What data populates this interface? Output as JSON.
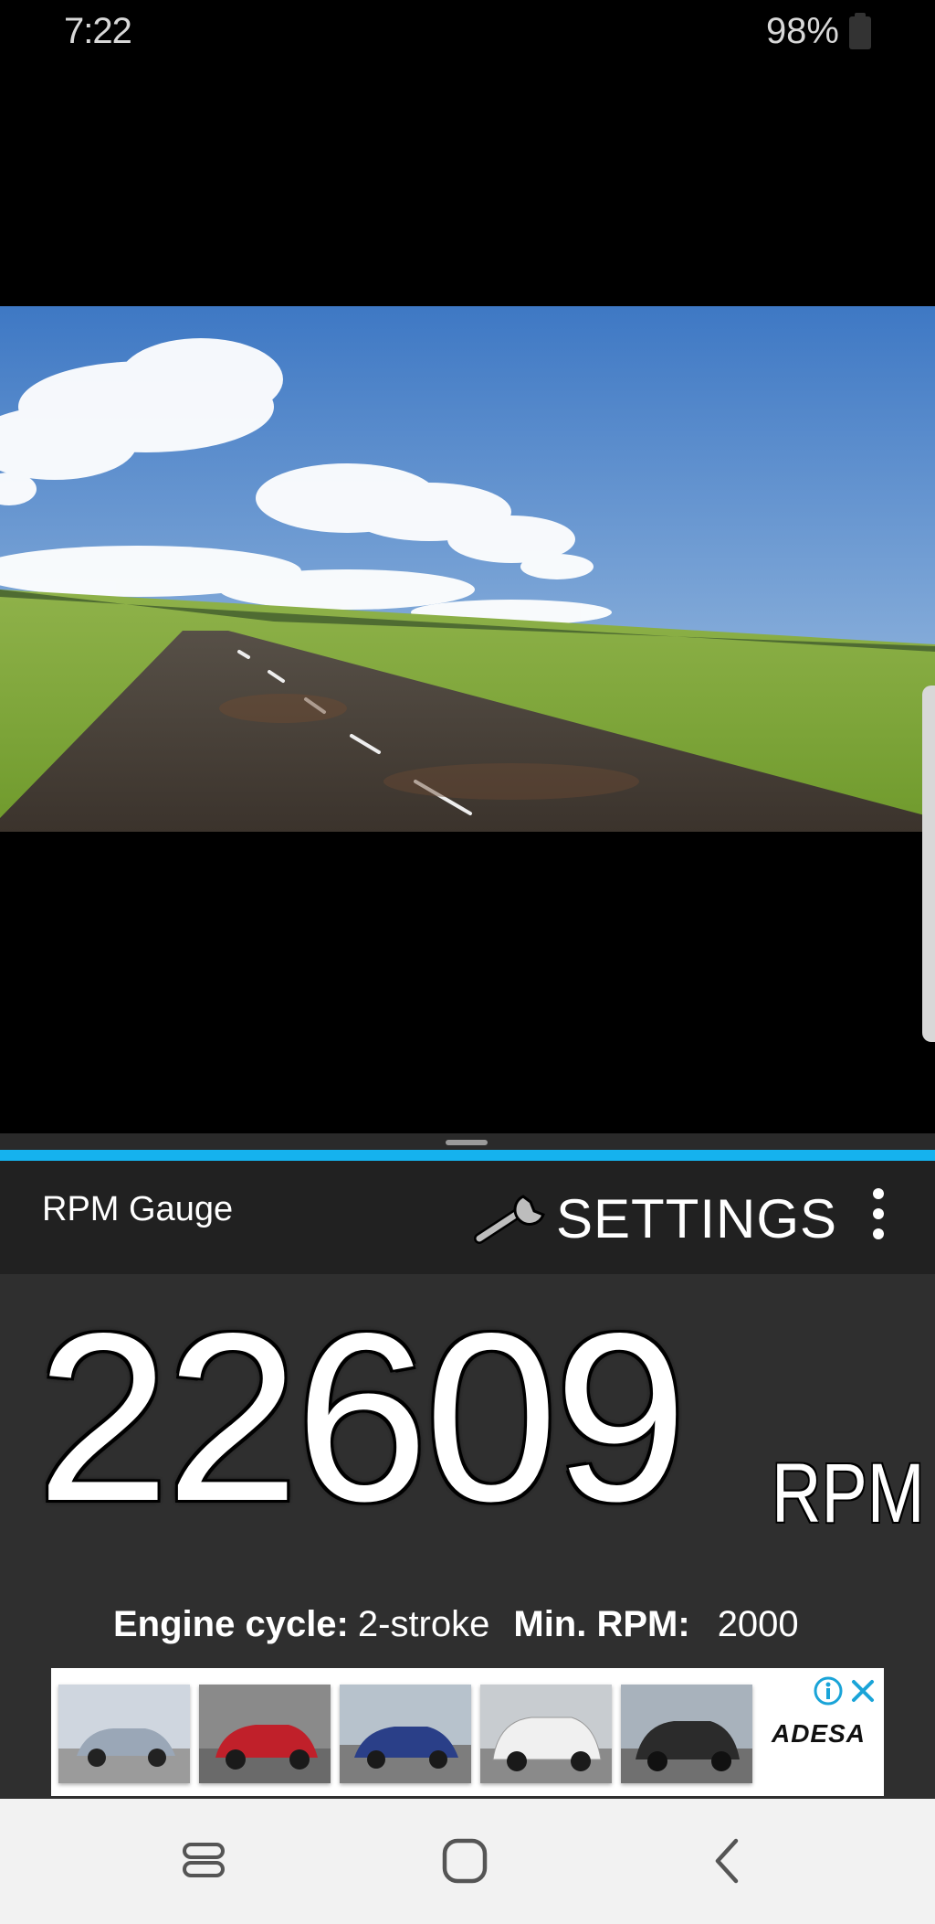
{
  "status_bar": {
    "time": "7:22",
    "battery": "98%"
  },
  "app": {
    "title": "RPM Gauge",
    "settings_label": "SETTINGS",
    "accent_color": "#15b2ee",
    "rpm_value": "22609",
    "rpm_unit": "RPM",
    "engine_cycle_label": "Engine cycle:",
    "engine_cycle_value": "2-stroke",
    "min_rpm_label": "Min. RPM:",
    "min_rpm_value": "2000"
  },
  "ad": {
    "brand": "ADESA",
    "thumbnails": [
      {
        "car_color": "#9aa7b7"
      },
      {
        "car_color": "#c0202a"
      },
      {
        "car_color": "#2a3f88"
      },
      {
        "car_color": "#f0f0f0"
      },
      {
        "car_color": "#2b2b2b"
      }
    ]
  },
  "icons": [
    "wrench-icon",
    "more-vert-icon",
    "ad-info-icon",
    "ad-close-icon",
    "recent-apps-icon",
    "home-icon",
    "back-icon"
  ]
}
